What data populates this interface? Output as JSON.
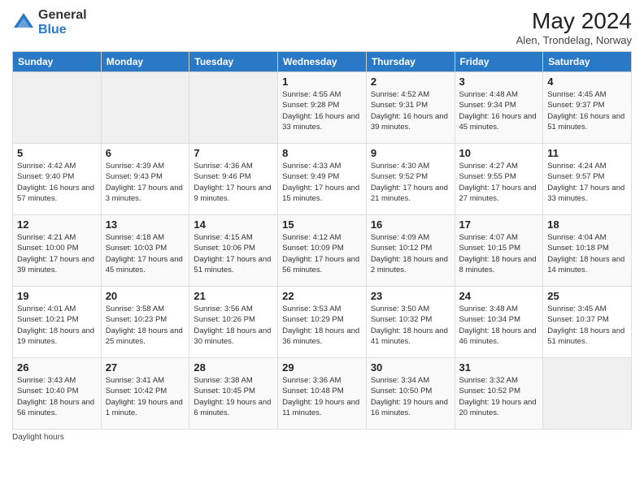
{
  "logo": {
    "text_general": "General",
    "text_blue": "Blue"
  },
  "header": {
    "month_year": "May 2024",
    "location": "Alen, Trondelag, Norway"
  },
  "days_of_week": [
    "Sunday",
    "Monday",
    "Tuesday",
    "Wednesday",
    "Thursday",
    "Friday",
    "Saturday"
  ],
  "weeks": [
    [
      {
        "day": "",
        "sunrise": "",
        "sunset": "",
        "daylight": "",
        "empty": true
      },
      {
        "day": "",
        "sunrise": "",
        "sunset": "",
        "daylight": "",
        "empty": true
      },
      {
        "day": "",
        "sunrise": "",
        "sunset": "",
        "daylight": "",
        "empty": true
      },
      {
        "day": "1",
        "sunrise": "Sunrise: 4:55 AM",
        "sunset": "Sunset: 9:28 PM",
        "daylight": "Daylight: 16 hours and 33 minutes."
      },
      {
        "day": "2",
        "sunrise": "Sunrise: 4:52 AM",
        "sunset": "Sunset: 9:31 PM",
        "daylight": "Daylight: 16 hours and 39 minutes."
      },
      {
        "day": "3",
        "sunrise": "Sunrise: 4:48 AM",
        "sunset": "Sunset: 9:34 PM",
        "daylight": "Daylight: 16 hours and 45 minutes."
      },
      {
        "day": "4",
        "sunrise": "Sunrise: 4:45 AM",
        "sunset": "Sunset: 9:37 PM",
        "daylight": "Daylight: 16 hours and 51 minutes."
      }
    ],
    [
      {
        "day": "5",
        "sunrise": "Sunrise: 4:42 AM",
        "sunset": "Sunset: 9:40 PM",
        "daylight": "Daylight: 16 hours and 57 minutes."
      },
      {
        "day": "6",
        "sunrise": "Sunrise: 4:39 AM",
        "sunset": "Sunset: 9:43 PM",
        "daylight": "Daylight: 17 hours and 3 minutes."
      },
      {
        "day": "7",
        "sunrise": "Sunrise: 4:36 AM",
        "sunset": "Sunset: 9:46 PM",
        "daylight": "Daylight: 17 hours and 9 minutes."
      },
      {
        "day": "8",
        "sunrise": "Sunrise: 4:33 AM",
        "sunset": "Sunset: 9:49 PM",
        "daylight": "Daylight: 17 hours and 15 minutes."
      },
      {
        "day": "9",
        "sunrise": "Sunrise: 4:30 AM",
        "sunset": "Sunset: 9:52 PM",
        "daylight": "Daylight: 17 hours and 21 minutes."
      },
      {
        "day": "10",
        "sunrise": "Sunrise: 4:27 AM",
        "sunset": "Sunset: 9:55 PM",
        "daylight": "Daylight: 17 hours and 27 minutes."
      },
      {
        "day": "11",
        "sunrise": "Sunrise: 4:24 AM",
        "sunset": "Sunset: 9:57 PM",
        "daylight": "Daylight: 17 hours and 33 minutes."
      }
    ],
    [
      {
        "day": "12",
        "sunrise": "Sunrise: 4:21 AM",
        "sunset": "Sunset: 10:00 PM",
        "daylight": "Daylight: 17 hours and 39 minutes."
      },
      {
        "day": "13",
        "sunrise": "Sunrise: 4:18 AM",
        "sunset": "Sunset: 10:03 PM",
        "daylight": "Daylight: 17 hours and 45 minutes."
      },
      {
        "day": "14",
        "sunrise": "Sunrise: 4:15 AM",
        "sunset": "Sunset: 10:06 PM",
        "daylight": "Daylight: 17 hours and 51 minutes."
      },
      {
        "day": "15",
        "sunrise": "Sunrise: 4:12 AM",
        "sunset": "Sunset: 10:09 PM",
        "daylight": "Daylight: 17 hours and 56 minutes."
      },
      {
        "day": "16",
        "sunrise": "Sunrise: 4:09 AM",
        "sunset": "Sunset: 10:12 PM",
        "daylight": "Daylight: 18 hours and 2 minutes."
      },
      {
        "day": "17",
        "sunrise": "Sunrise: 4:07 AM",
        "sunset": "Sunset: 10:15 PM",
        "daylight": "Daylight: 18 hours and 8 minutes."
      },
      {
        "day": "18",
        "sunrise": "Sunrise: 4:04 AM",
        "sunset": "Sunset: 10:18 PM",
        "daylight": "Daylight: 18 hours and 14 minutes."
      }
    ],
    [
      {
        "day": "19",
        "sunrise": "Sunrise: 4:01 AM",
        "sunset": "Sunset: 10:21 PM",
        "daylight": "Daylight: 18 hours and 19 minutes."
      },
      {
        "day": "20",
        "sunrise": "Sunrise: 3:58 AM",
        "sunset": "Sunset: 10:23 PM",
        "daylight": "Daylight: 18 hours and 25 minutes."
      },
      {
        "day": "21",
        "sunrise": "Sunrise: 3:56 AM",
        "sunset": "Sunset: 10:26 PM",
        "daylight": "Daylight: 18 hours and 30 minutes."
      },
      {
        "day": "22",
        "sunrise": "Sunrise: 3:53 AM",
        "sunset": "Sunset: 10:29 PM",
        "daylight": "Daylight: 18 hours and 36 minutes."
      },
      {
        "day": "23",
        "sunrise": "Sunrise: 3:50 AM",
        "sunset": "Sunset: 10:32 PM",
        "daylight": "Daylight: 18 hours and 41 minutes."
      },
      {
        "day": "24",
        "sunrise": "Sunrise: 3:48 AM",
        "sunset": "Sunset: 10:34 PM",
        "daylight": "Daylight: 18 hours and 46 minutes."
      },
      {
        "day": "25",
        "sunrise": "Sunrise: 3:45 AM",
        "sunset": "Sunset: 10:37 PM",
        "daylight": "Daylight: 18 hours and 51 minutes."
      }
    ],
    [
      {
        "day": "26",
        "sunrise": "Sunrise: 3:43 AM",
        "sunset": "Sunset: 10:40 PM",
        "daylight": "Daylight: 18 hours and 56 minutes."
      },
      {
        "day": "27",
        "sunrise": "Sunrise: 3:41 AM",
        "sunset": "Sunset: 10:42 PM",
        "daylight": "Daylight: 19 hours and 1 minute."
      },
      {
        "day": "28",
        "sunrise": "Sunrise: 3:38 AM",
        "sunset": "Sunset: 10:45 PM",
        "daylight": "Daylight: 19 hours and 6 minutes."
      },
      {
        "day": "29",
        "sunrise": "Sunrise: 3:36 AM",
        "sunset": "Sunset: 10:48 PM",
        "daylight": "Daylight: 19 hours and 11 minutes."
      },
      {
        "day": "30",
        "sunrise": "Sunrise: 3:34 AM",
        "sunset": "Sunset: 10:50 PM",
        "daylight": "Daylight: 19 hours and 16 minutes."
      },
      {
        "day": "31",
        "sunrise": "Sunrise: 3:32 AM",
        "sunset": "Sunset: 10:52 PM",
        "daylight": "Daylight: 19 hours and 20 minutes."
      },
      {
        "day": "",
        "sunrise": "",
        "sunset": "",
        "daylight": "",
        "empty": true
      }
    ]
  ],
  "footer": {
    "daylight_label": "Daylight hours"
  }
}
